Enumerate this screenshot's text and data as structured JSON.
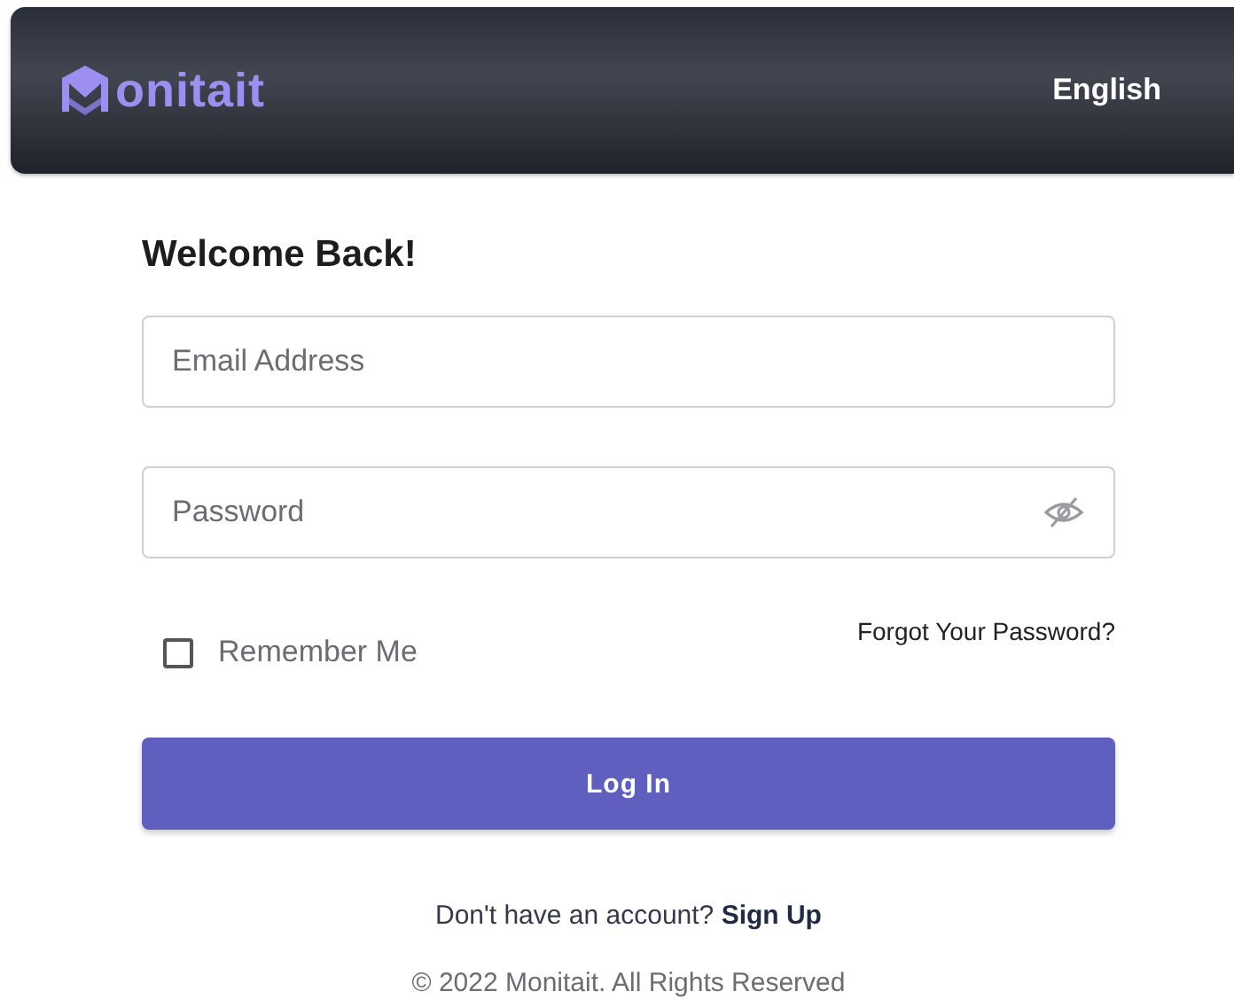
{
  "header": {
    "logo_text": "onitait",
    "language": "English"
  },
  "form": {
    "title": "Welcome Back!",
    "fields": [
      {
        "kind": "text",
        "placeholder": "Email Address"
      },
      {
        "kind": "password",
        "placeholder": "Password"
      }
    ],
    "remember": {
      "label": "Remember Me",
      "checked": false
    },
    "forgot_link": "Forgot Your Password?",
    "submit": "Log In"
  },
  "signup": {
    "prompt": "Don't have an account?",
    "link": "Sign Up"
  },
  "copyright": "© 2022 Monitait. All Rights Reserved"
}
